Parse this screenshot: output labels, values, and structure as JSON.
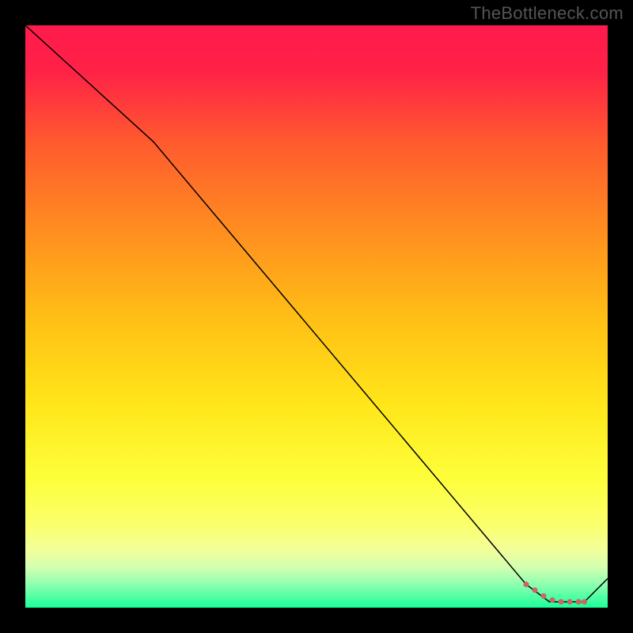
{
  "watermark": {
    "text": "TheBottleneck.com"
  },
  "chart_data": {
    "type": "line",
    "title": "",
    "xlabel": "",
    "ylabel": "",
    "xlim": [
      0,
      100
    ],
    "ylim": [
      0,
      100
    ],
    "series": [
      {
        "name": "curve",
        "x": [
          0,
          22,
          86,
          90,
          96,
          100
        ],
        "values": [
          100,
          80,
          4,
          1,
          1,
          5
        ],
        "stroke": "#000000"
      }
    ],
    "marker_series": {
      "name": "markers",
      "x": [
        86,
        87.5,
        89,
        90.5,
        92,
        93.5,
        95,
        96
      ],
      "values": [
        4,
        3,
        2,
        1.3,
        1,
        1,
        1,
        1
      ],
      "color": "#cc6666"
    },
    "gradient_stops": [
      {
        "offset": 0,
        "color": "#ff1a4d"
      },
      {
        "offset": 8,
        "color": "#ff2247"
      },
      {
        "offset": 20,
        "color": "#ff5a2e"
      },
      {
        "offset": 35,
        "color": "#ff8d20"
      },
      {
        "offset": 50,
        "color": "#ffbe15"
      },
      {
        "offset": 65,
        "color": "#ffe61a"
      },
      {
        "offset": 78,
        "color": "#fdff3b"
      },
      {
        "offset": 86,
        "color": "#fbff6e"
      },
      {
        "offset": 90,
        "color": "#f2ff9a"
      },
      {
        "offset": 93,
        "color": "#d4ffb0"
      },
      {
        "offset": 96,
        "color": "#8effb0"
      },
      {
        "offset": 100,
        "color": "#1aff99"
      }
    ]
  }
}
